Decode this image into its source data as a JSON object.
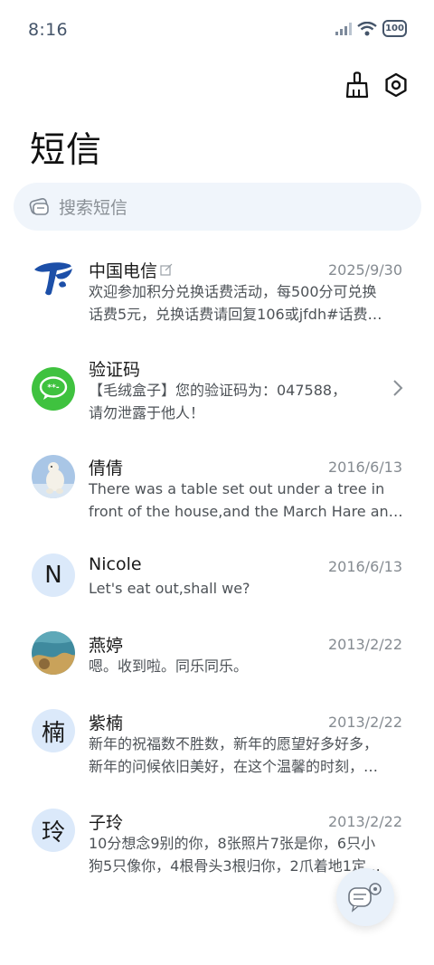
{
  "status_bar": {
    "time": "8:16",
    "battery": "100"
  },
  "header": {
    "title": "短信"
  },
  "search": {
    "placeholder": "搜索短信"
  },
  "conversations": [
    {
      "name": "中国电信",
      "date": "2025/9/30",
      "line1": "欢迎参加积分兑换话费活动，每500分可兑换",
      "line2": "话费5元，兑换话费请回复106或jfdh#话费…"
    },
    {
      "name": "验证码",
      "date": "",
      "line1": "【毛绒盒子】您的验证码为：047588，",
      "line2": "请勿泄露于他人！"
    },
    {
      "name": "倩倩",
      "date": "2016/6/13",
      "line1": "There was a table set out under a tree in",
      "line2": "front of the house,and the March Hare an…"
    },
    {
      "name": "Nicole",
      "date": "2016/6/13",
      "initial": "N",
      "line1": "Let's eat out,shall we?",
      "line2": ""
    },
    {
      "name": "燕婷",
      "date": "2013/2/22",
      "line1": "嗯。收到啦。同乐同乐。",
      "line2": ""
    },
    {
      "name": "紫楠",
      "date": "2013/2/22",
      "initial": "楠",
      "line1": "新年的祝福数不胜数，新年的愿望好多好多，",
      "line2": "新年的问候依旧美好，在这个温馨的时刻，…"
    },
    {
      "name": "子玲",
      "date": "2013/2/22",
      "initial": "玲",
      "line1": "10分想念9别的你，8张照片7张是你，6只小",
      "line2": "狗5只像你，4根骨头3根归你，2爪着地1定…"
    }
  ],
  "colors": {
    "accent": "#1f5fbf",
    "search_bg": "#f0f5fb",
    "avatar_bg": "#dbe9fa",
    "verify_green": "#3fc23f"
  },
  "icons": [
    "signal-icon",
    "wifi-icon",
    "battery-icon",
    "broom-icon",
    "settings-icon",
    "search-icon",
    "chevron-right-icon",
    "compose-icon"
  ]
}
